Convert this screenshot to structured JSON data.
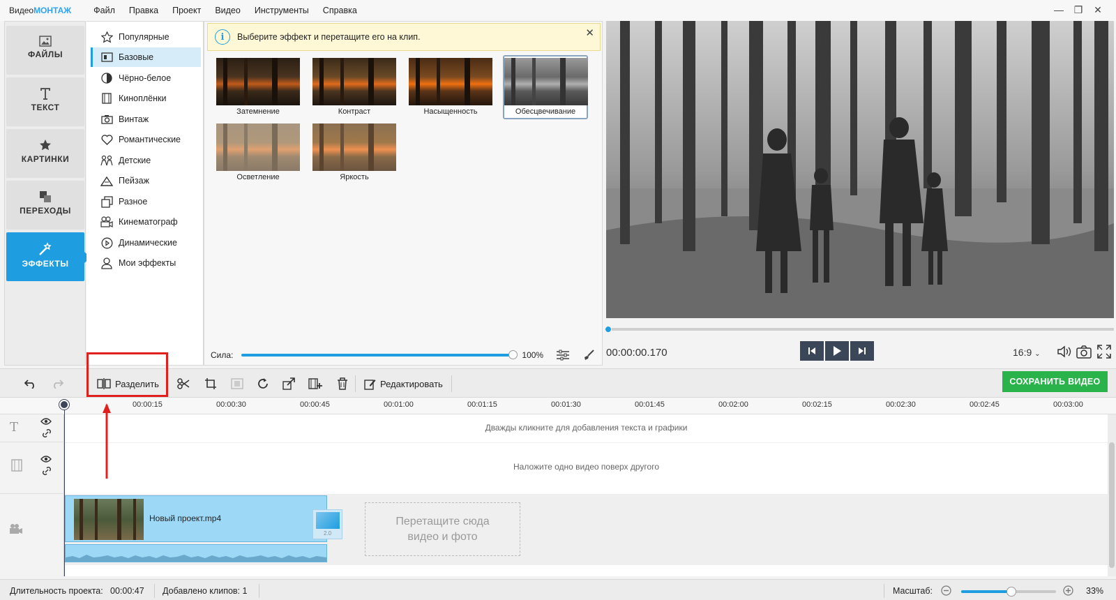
{
  "app": {
    "logo_prefix": "Видео",
    "logo_brand": "МОНТАЖ"
  },
  "menu": [
    "Файл",
    "Правка",
    "Проект",
    "Видео",
    "Инструменты",
    "Справка"
  ],
  "window_controls": {
    "minimize": "—",
    "restore": "❐",
    "close": "✕"
  },
  "nav": [
    {
      "label": "ФАЙЛЫ",
      "icon": "image-icon",
      "active": false
    },
    {
      "label": "ТЕКСТ",
      "icon": "text-icon",
      "active": false
    },
    {
      "label": "КАРТИНКИ",
      "icon": "star-icon",
      "active": false
    },
    {
      "label": "ПЕРЕХОДЫ",
      "icon": "transitions-icon",
      "active": false
    },
    {
      "label": "ЭФФЕКТЫ",
      "icon": "effects-wand-icon",
      "active": true
    }
  ],
  "categories": [
    {
      "label": "Популярные",
      "icon": "star-outline-icon"
    },
    {
      "label": "Базовые",
      "icon": "basic-effects-icon",
      "selected": true
    },
    {
      "label": "Чёрно-белое",
      "icon": "bw-icon"
    },
    {
      "label": "Киноплёнки",
      "icon": "film-icon"
    },
    {
      "label": "Винтаж",
      "icon": "camera-icon"
    },
    {
      "label": "Романтические",
      "icon": "heart-icon"
    },
    {
      "label": "Детские",
      "icon": "kids-icon"
    },
    {
      "label": "Пейзаж",
      "icon": "mountain-icon"
    },
    {
      "label": "Разное",
      "icon": "misc-icon"
    },
    {
      "label": "Кинематограф",
      "icon": "movie-camera-icon"
    },
    {
      "label": "Динамические",
      "icon": "play-circle-icon"
    },
    {
      "label": "Мои эффекты",
      "icon": "user-icon"
    }
  ],
  "info_bar": {
    "text": "Выберите эффект и перетащите его на клип.",
    "icon": "i",
    "close": "✕"
  },
  "effects": [
    {
      "label": "Затемнение",
      "style": "dark"
    },
    {
      "label": "Контраст",
      "style": "contrast"
    },
    {
      "label": "Насыщенность",
      "style": "saturate"
    },
    {
      "label": "Обесцвечивание",
      "style": "gray",
      "selected": true
    },
    {
      "label": "Осветление",
      "style": "light"
    },
    {
      "label": "Яркость",
      "style": "bright"
    }
  ],
  "strength": {
    "label": "Сила:",
    "value_text": "100%",
    "value": 1.0
  },
  "preview": {
    "timecode": "00:00:00.170",
    "aspect": "16:9",
    "progress": 0.0
  },
  "toolbar": {
    "split_label": "Разделить",
    "edit_label": "Редактировать",
    "save_label": "СОХРАНИТЬ ВИДЕО"
  },
  "ruler": [
    "00:00:15",
    "00:00:30",
    "00:00:45",
    "00:01:00",
    "00:01:15",
    "00:01:30",
    "00:01:45",
    "00:02:00",
    "00:02:15",
    "00:02:30",
    "00:02:45",
    "00:03:00"
  ],
  "timeline": {
    "text_hint": "Дважды кликните для добавления текста и графики",
    "overlay_hint": "Наложите одно видео поверх другого",
    "clip_name": "Новый проект.mp4",
    "transition_duration": "2.0",
    "drop_line1": "Перетащите сюда",
    "drop_line2": "видео и фото"
  },
  "status": {
    "duration_label": "Длительность проекта:",
    "duration_value": "00:00:47",
    "clips_label": "Добавлено клипов: 1",
    "zoom_label": "Масштаб:",
    "zoom_value": "33%",
    "zoom_level": 0.33
  },
  "colors": {
    "accent": "#1e9ee0",
    "save": "#29b34a",
    "highlight": "#e0201c"
  }
}
